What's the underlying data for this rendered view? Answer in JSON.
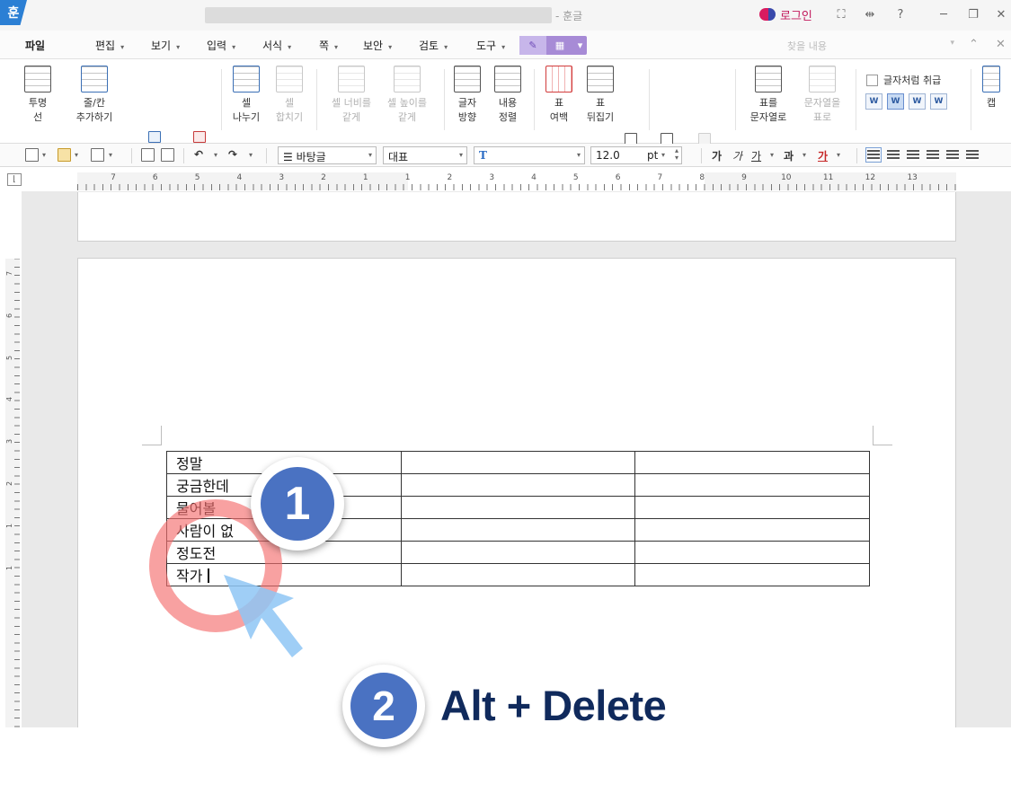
{
  "titlebar": {
    "app_logo": "훈",
    "title_suffix": "- 훈글",
    "login_label": "로그인",
    "controls": [
      "⛶",
      "⇹",
      "?",
      "─",
      "❐",
      "✕"
    ]
  },
  "menubar": {
    "items": [
      {
        "label": "파일"
      },
      {
        "label": "편집"
      },
      {
        "label": "보기"
      },
      {
        "label": "입력"
      },
      {
        "label": "서식"
      },
      {
        "label": "쪽"
      },
      {
        "label": "보안"
      },
      {
        "label": "검토"
      },
      {
        "label": "도구"
      }
    ],
    "find_placeholder": "찾을 내용",
    "controls": [
      "⌄",
      "⌃",
      "✕"
    ]
  },
  "ribbon": {
    "buttons": [
      {
        "label": "투명\n선",
        "icon": "transparent-line-icon"
      },
      {
        "label": "줄/칸\n추가하기",
        "icon": "insert-row-col-icon"
      },
      {
        "label": "셀\n나누기",
        "icon": "split-cell-icon"
      },
      {
        "label": "셀\n합치기",
        "icon": "merge-cell-icon"
      },
      {
        "label": "셀 너비를\n같게",
        "icon": "equal-width-icon"
      },
      {
        "label": "셀 높이를\n같게",
        "icon": "equal-height-icon"
      },
      {
        "label": "글자\n방향",
        "icon": "text-direction-icon"
      },
      {
        "label": "내용\n정렬",
        "icon": "content-align-icon"
      },
      {
        "label": "표\n여백",
        "icon": "table-margin-icon"
      },
      {
        "label": "표\n뒤집기",
        "icon": "flip-table-icon"
      },
      {
        "label": "표를\n문자열로",
        "icon": "table-to-text-icon"
      },
      {
        "label": "문자열을\n표로",
        "icon": "text-to-table-icon"
      },
      {
        "label": "캡",
        "icon": "caption-icon"
      }
    ],
    "treat_as_char_label": "글자처럼 취급",
    "align_marks": [
      "W",
      "W",
      "W",
      "W"
    ]
  },
  "format_bar": {
    "style_value": "바탕글",
    "category_value": "대표",
    "font_value": "",
    "font_icon": "T",
    "size_value": "12.0",
    "size_unit": "pt",
    "char_buttons": [
      "가",
      "가",
      "가",
      "과",
      "가"
    ]
  },
  "ruler": {
    "h_numbers": [
      "7",
      "6",
      "5",
      "4",
      "3",
      "2",
      "1",
      "1",
      "2",
      "3",
      "4",
      "5",
      "6",
      "7",
      "8",
      "9",
      "10",
      "11",
      "12",
      "13"
    ],
    "v_numbers": [
      "7",
      "6",
      "5",
      "4",
      "3",
      "2",
      "1",
      "1"
    ]
  },
  "document": {
    "table": [
      [
        "정말",
        "",
        ""
      ],
      [
        "궁금한데",
        "",
        ""
      ],
      [
        "물어볼",
        "",
        ""
      ],
      [
        "사람이 없",
        "",
        ""
      ],
      [
        "정도전",
        "",
        ""
      ],
      [
        "작가",
        "",
        ""
      ]
    ]
  },
  "annotations": {
    "step1_number": "1",
    "step2_number": "2",
    "shortcut_text": "Alt + Delete",
    "ring_color": "#f56e6e",
    "badge_color": "#4a72c2",
    "arrow_color": "#8ec5f5"
  }
}
